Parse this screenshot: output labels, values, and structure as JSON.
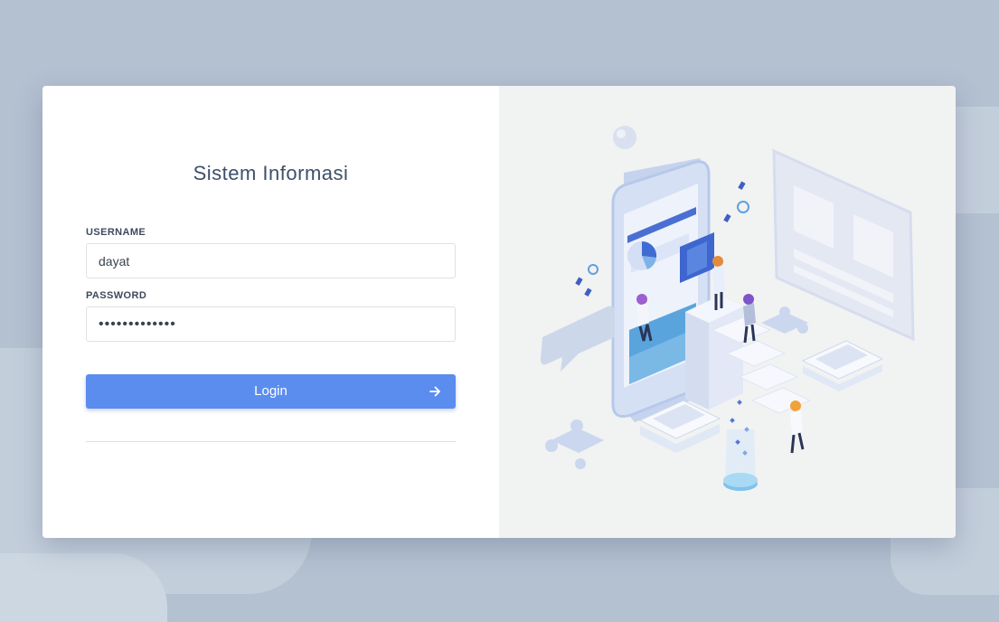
{
  "login": {
    "title": "Sistem Informasi",
    "username_label": "USERNAME",
    "username_value": "dayat",
    "password_label": "PASSWORD",
    "password_value": "•••••••••••••",
    "login_button_label": "Login",
    "login_button_icon": "arrow-right-icon"
  },
  "colors": {
    "background": "#b4c1d1",
    "card": "#ffffff",
    "illustration_panel": "#f1f2f2",
    "primary_button": "#5b8def",
    "title_text": "#3e5068"
  }
}
